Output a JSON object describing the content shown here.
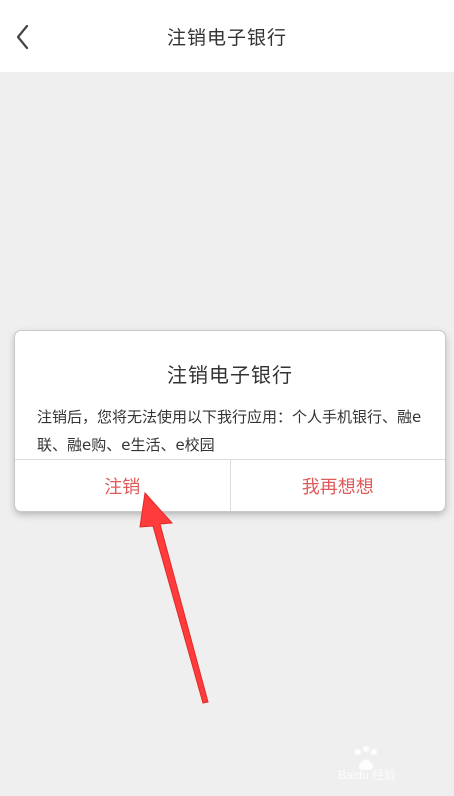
{
  "nav": {
    "title": "注销电子银行",
    "back_icon": "chevron-left-icon"
  },
  "dialog": {
    "title": "注销电子银行",
    "message": "注销后，您将无法使用以下我行应用：个人手机银行、融e联、融e购、e生活、e校园",
    "confirm_label": "注销",
    "cancel_label": "我再想想"
  },
  "annotation": {
    "arrow_color": "#ff3b3b"
  },
  "watermark": {
    "text": "Baidu 经验"
  },
  "colors": {
    "accent_red": "#e05a5a",
    "background": "#efefef"
  }
}
